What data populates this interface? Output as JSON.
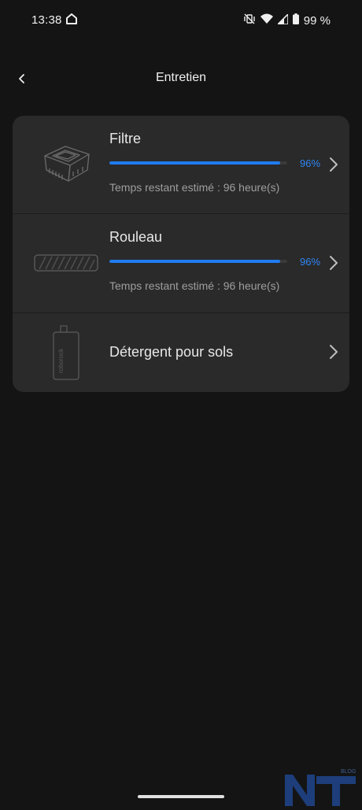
{
  "status_bar": {
    "time": "13:38",
    "battery": "99 %"
  },
  "appbar": {
    "title": "Entretien"
  },
  "items": [
    {
      "name": "Filtre",
      "progress": 96,
      "progress_label": "96%",
      "remaining": "Temps restant estimé : 96 heure(s)"
    },
    {
      "name": "Rouleau",
      "progress": 96,
      "progress_label": "96%",
      "remaining": "Temps restant estimé : 96 heure(s)"
    },
    {
      "name": "Détergent pour sols"
    }
  ],
  "product_brand": "roborock",
  "watermark": {
    "letters": "NT",
    "tag": "BLOG"
  },
  "colors": {
    "accent": "#1f7bf0",
    "background": "#141414",
    "card": "#2a2a2a"
  }
}
